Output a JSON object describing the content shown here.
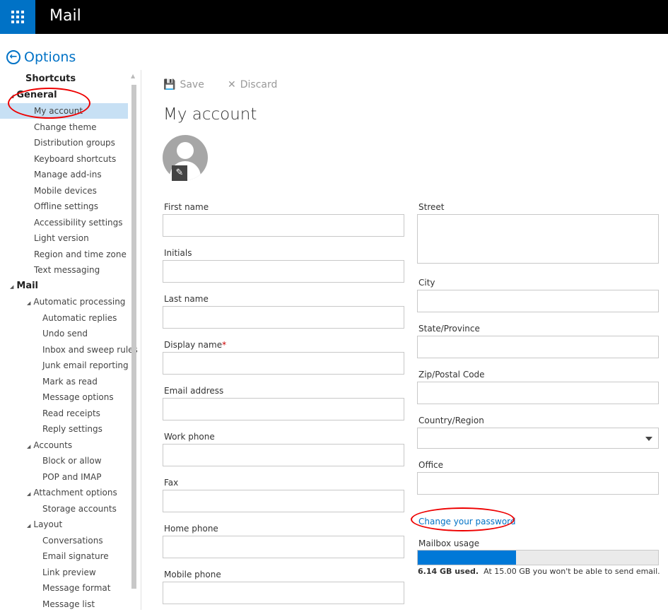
{
  "header": {
    "app_title": "Mail"
  },
  "options_title": "Options",
  "sidebar": [
    {
      "label": "Shortcuts",
      "level": 0,
      "heading": true
    },
    {
      "label": "General",
      "level": 0,
      "heading": true,
      "expanded": true
    },
    {
      "label": "My account",
      "level": 1,
      "selected": true
    },
    {
      "label": "Change theme",
      "level": 1
    },
    {
      "label": "Distribution groups",
      "level": 1
    },
    {
      "label": "Keyboard shortcuts",
      "level": 1
    },
    {
      "label": "Manage add-ins",
      "level": 1
    },
    {
      "label": "Mobile devices",
      "level": 1
    },
    {
      "label": "Offline settings",
      "level": 1
    },
    {
      "label": "Accessibility settings",
      "level": 1
    },
    {
      "label": "Light version",
      "level": 1
    },
    {
      "label": "Region and time zone",
      "level": 1
    },
    {
      "label": "Text messaging",
      "level": 1
    },
    {
      "label": "Mail",
      "level": 0,
      "heading": true,
      "expanded": true
    },
    {
      "label": "Automatic processing",
      "level": 1,
      "expanded": true
    },
    {
      "label": "Automatic replies",
      "level": 2
    },
    {
      "label": "Undo send",
      "level": 2
    },
    {
      "label": "Inbox and sweep rules",
      "level": 2
    },
    {
      "label": "Junk email reporting",
      "level": 2
    },
    {
      "label": "Mark as read",
      "level": 2
    },
    {
      "label": "Message options",
      "level": 2
    },
    {
      "label": "Read receipts",
      "level": 2
    },
    {
      "label": "Reply settings",
      "level": 2
    },
    {
      "label": "Accounts",
      "level": 1,
      "expanded": true
    },
    {
      "label": "Block or allow",
      "level": 2
    },
    {
      "label": "POP and IMAP",
      "level": 2
    },
    {
      "label": "Attachment options",
      "level": 1,
      "expanded": true
    },
    {
      "label": "Storage accounts",
      "level": 2
    },
    {
      "label": "Layout",
      "level": 1,
      "expanded": true
    },
    {
      "label": "Conversations",
      "level": 2
    },
    {
      "label": "Email signature",
      "level": 2
    },
    {
      "label": "Link preview",
      "level": 2
    },
    {
      "label": "Message format",
      "level": 2
    },
    {
      "label": "Message list",
      "level": 2
    }
  ],
  "toolbar": {
    "save": "Save",
    "discard": "Discard"
  },
  "page_title": "My account",
  "left_fields": [
    {
      "label": "First name"
    },
    {
      "label": "Initials"
    },
    {
      "label": "Last name"
    },
    {
      "label": "Display name",
      "required": true
    },
    {
      "label": "Email address"
    },
    {
      "label": "Work phone"
    },
    {
      "label": "Fax"
    },
    {
      "label": "Home phone"
    },
    {
      "label": "Mobile phone"
    }
  ],
  "right_fields": [
    {
      "label": "Street"
    },
    {
      "label": "City"
    },
    {
      "label": "State/Province"
    },
    {
      "label": "Zip/Postal Code"
    },
    {
      "label": "Country/Region",
      "type": "dropdown"
    },
    {
      "label": "Office"
    }
  ],
  "required_mark": "*",
  "change_password": "Change your password",
  "mailbox": {
    "label": "Mailbox usage",
    "used_gb": 6.14,
    "limit_gb": 15.0,
    "used_text": "6.14 GB used.",
    "limit_text": "At 15.00 GB you won't be able to send email."
  },
  "colors": {
    "accent": "#0072c6",
    "usage_fill": "#0078d7",
    "selected": "#c7e0f4"
  }
}
